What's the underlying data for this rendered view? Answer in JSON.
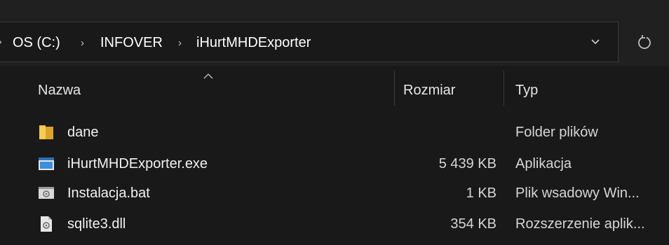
{
  "breadcrumb": {
    "items": [
      "OS (C:)",
      "INFOVER",
      "iHurtMHDExporter"
    ]
  },
  "columns": {
    "name": "Nazwa",
    "size": "Rozmiar",
    "type": "Typ"
  },
  "files": [
    {
      "name": "dane",
      "size": "",
      "type": "Folder plików",
      "icon": "folder-icon"
    },
    {
      "name": "iHurtMHDExporter.exe",
      "size": "5 439 KB",
      "type": "Aplikacja",
      "icon": "application-icon"
    },
    {
      "name": "Instalacja.bat",
      "size": "1 KB",
      "type": "Plik wsadowy Win...",
      "icon": "batch-file-icon"
    },
    {
      "name": "sqlite3.dll",
      "size": "354 KB",
      "type": "Rozszerzenie aplik...",
      "icon": "dll-file-icon"
    }
  ],
  "colors": {
    "background": "#191919",
    "toolbar": "#202020",
    "folder": "#f4c13d",
    "app_icon": "#3b8fdc"
  }
}
